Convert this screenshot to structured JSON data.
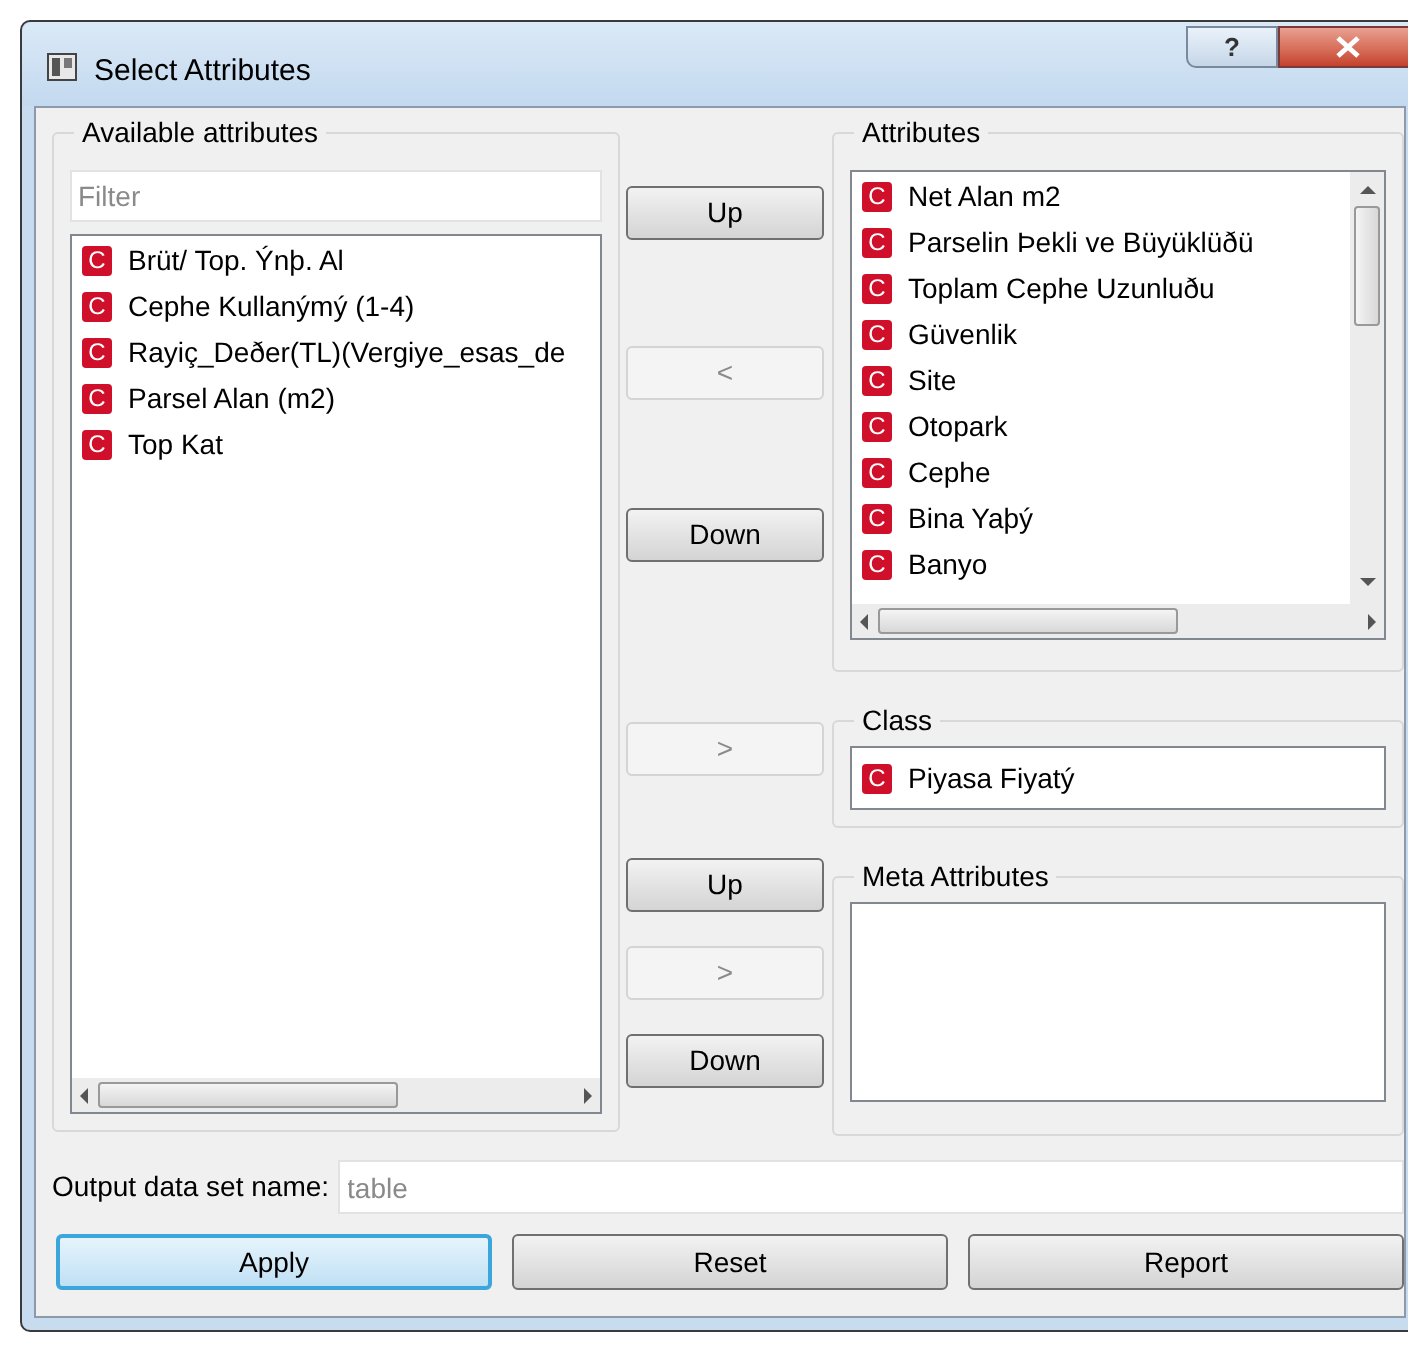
{
  "window": {
    "title": "Select Attributes",
    "help": "?"
  },
  "available": {
    "title": "Available attributes",
    "filter": {
      "placeholder": "Filter"
    },
    "items": [
      {
        "badge": "C",
        "label": "Brüt/ Top. Ýnþ. Al"
      },
      {
        "badge": "C",
        "label": "Cephe Kullanýmý (1-4)"
      },
      {
        "badge": "C",
        "label": "Rayiç_Deðer(TL)(Vergiye_esas_de"
      },
      {
        "badge": "C",
        "label": "Parsel Alan (m2)"
      },
      {
        "badge": "C",
        "label": "Top Kat"
      }
    ]
  },
  "middle_buttons": [
    {
      "label": "Up",
      "disabled": false
    },
    {
      "label": "<",
      "disabled": true
    },
    {
      "label": "Down",
      "disabled": false
    },
    {
      "label": ">",
      "disabled": true
    },
    {
      "label": "Up",
      "disabled": false
    },
    {
      "label": ">",
      "disabled": true
    },
    {
      "label": "Down",
      "disabled": false
    }
  ],
  "attributes": {
    "title": "Attributes",
    "items": [
      {
        "badge": "C",
        "label": "Net Alan m2"
      },
      {
        "badge": "C",
        "label": "Parselin Þekli ve Büyüklüðü"
      },
      {
        "badge": "C",
        "label": "Toplam Cephe Uzunluðu"
      },
      {
        "badge": "C",
        "label": "Güvenlik"
      },
      {
        "badge": "C",
        "label": "Site"
      },
      {
        "badge": "C",
        "label": "Otopark"
      },
      {
        "badge": "C",
        "label": "Cephe"
      },
      {
        "badge": "C",
        "label": "Bina Yaþý"
      },
      {
        "badge": "C",
        "label": "Banyo"
      }
    ]
  },
  "class": {
    "title": "Class",
    "item": {
      "badge": "C",
      "label": "Piyasa Fiyatý"
    }
  },
  "meta": {
    "title": "Meta Attributes"
  },
  "output": {
    "label": "Output data set name:",
    "placeholder": "table"
  },
  "buttons": [
    {
      "label": "Apply",
      "selected": true
    },
    {
      "label": "Reset",
      "selected": false
    },
    {
      "label": "Report",
      "selected": false
    }
  ]
}
